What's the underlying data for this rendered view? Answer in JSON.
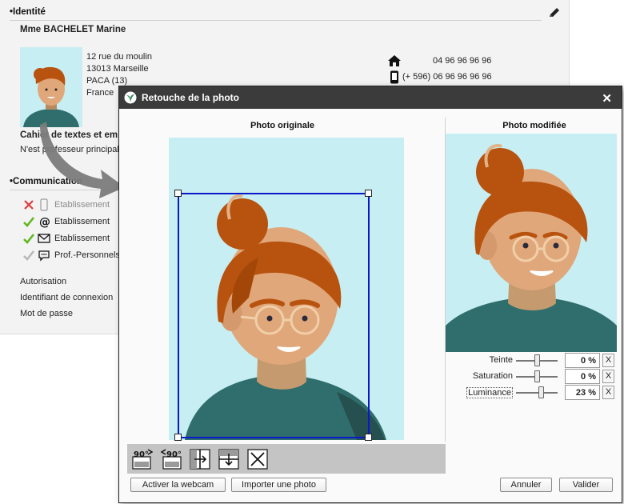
{
  "profile": {
    "identity_title": "•Identité",
    "name": "Mme BACHELET Marine",
    "address": [
      "12 rue du moulin",
      "13013  Marseille",
      "PACA (13)",
      "France"
    ],
    "phone_home": "04 96 96 96 96",
    "phone_mobile": "(+ 596) 06 96 96 96 96",
    "cahier_title": "Cahier de textes et em",
    "cahier_sub": "N'est professeur principal",
    "communication_title": "•Communication",
    "comm_items": [
      {
        "status": "cross",
        "icon": "mobile-phone-icon",
        "label": "Etablissement",
        "muted": true
      },
      {
        "status": "check",
        "icon": "at-sign-icon",
        "label": "Etablissement",
        "muted": false
      },
      {
        "status": "check",
        "icon": "envelope-icon",
        "label": "Etablissement",
        "muted": false
      },
      {
        "status": "check-grey",
        "icon": "chat-bubble-icon",
        "label": "Prof.-Personnels",
        "muted": false
      }
    ],
    "links": [
      "Autorisation",
      "Identifiant de connexion",
      "Mot de passe"
    ]
  },
  "dialog": {
    "title": "Retouche de la photo",
    "close_label": "✕",
    "original_title": "Photo originale",
    "modified_title": "Photo modifiée",
    "toolbar": [
      {
        "name": "rotate-left-90-button",
        "label": "90°",
        "icon": "rotate-left-icon"
      },
      {
        "name": "rotate-right-90-button",
        "label": "90°",
        "icon": "rotate-right-icon"
      },
      {
        "name": "flip-horizontal-button",
        "icon": "flip-horizontal-icon"
      },
      {
        "name": "flip-vertical-button",
        "icon": "flip-vertical-icon"
      },
      {
        "name": "delete-photo-button",
        "icon": "delete-x-icon"
      }
    ],
    "adjustments": [
      {
        "label": "Teinte",
        "value": "0",
        "unit": "%",
        "level": 0.5
      },
      {
        "label": "Saturation",
        "value": "0",
        "unit": "%",
        "level": 0.5
      },
      {
        "label": "Luminance",
        "value": "23",
        "unit": "%",
        "level": 0.6
      }
    ],
    "reset_label": "X",
    "buttons": {
      "webcam": "Activer la webcam",
      "import": "Importer une photo",
      "cancel": "Annuler",
      "validate": "Valider"
    }
  },
  "colors": {
    "photo_bg": "#c7eef2",
    "hair": "#b8520f",
    "skin": "#e0a77a",
    "shirt": "#2f6e6c",
    "crop_border": "#0a18c8",
    "titlebar": "#3b3b3b",
    "check": "#5fb820",
    "cross": "#e03c3c"
  }
}
